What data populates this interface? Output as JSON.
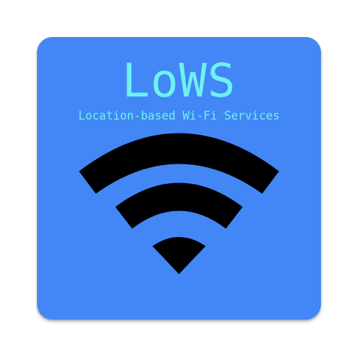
{
  "app": {
    "title": "LoWS",
    "subtitle": "Location-based Wi-Fi Services"
  },
  "icons": {
    "main": "wifi-icon"
  },
  "colors": {
    "background": "#4287f5",
    "text": "#6df2f2",
    "wifi": "#000000"
  }
}
